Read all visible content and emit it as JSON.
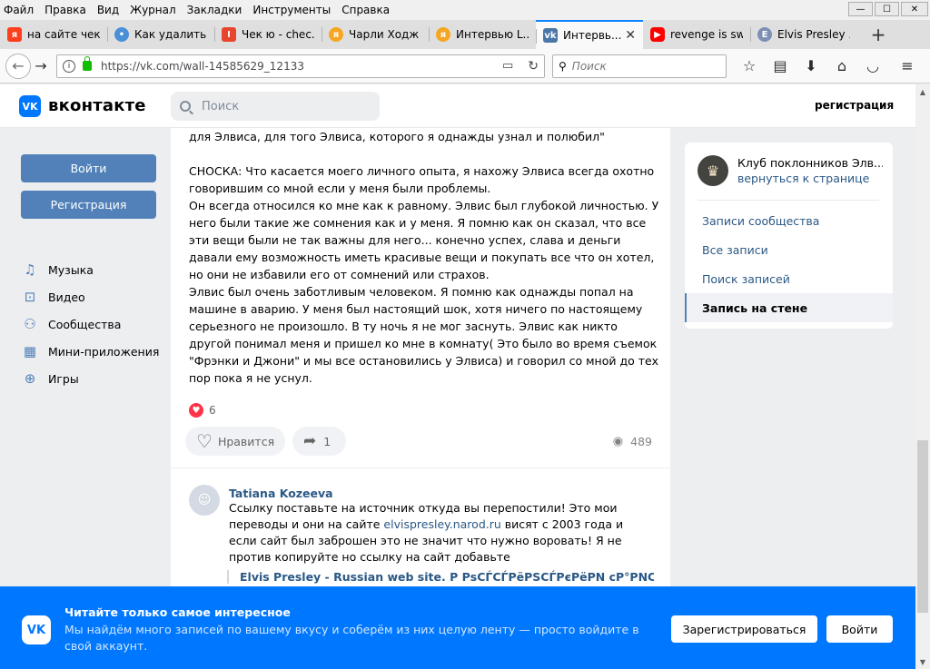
{
  "menubar": {
    "items": [
      "Файл",
      "Правка",
      "Вид",
      "Журнал",
      "Закладки",
      "Инструменты",
      "Справка"
    ],
    "window_controls": {
      "minimize": "—",
      "maximize": "☐",
      "close": "✕"
    }
  },
  "tabs": [
    {
      "title": "на сайте чек...",
      "icon": "yandex-icon",
      "color": "#f33"
    },
    {
      "title": "Как удалить ...",
      "icon": "chat-icon",
      "color": "#4a90d9"
    },
    {
      "title": "Чек ю - chec...",
      "icon": "checkyou-icon",
      "color": "#e8452c"
    },
    {
      "title": "Чарли Ходж ...",
      "icon": "yandex-zen-icon",
      "color": "#f5a623"
    },
    {
      "title": "Интервью L...",
      "icon": "yandex-zen-icon",
      "color": "#f5a623"
    },
    {
      "title": "Интервь...",
      "icon": "vk-icon",
      "color": "#4a76a8",
      "active": true
    },
    {
      "title": "revenge is sw...",
      "icon": "youtube-icon",
      "color": "#f00"
    },
    {
      "title": "Elvis Presley ...",
      "icon": "elvis-site-icon",
      "color": "#7d8fb3"
    }
  ],
  "navbar": {
    "url": "https://vk.com/wall-14585629_12133",
    "search_placeholder": "Поиск"
  },
  "vk": {
    "brand": "вконтакте",
    "search_placeholder": "Поиск",
    "register_link": "регистрация",
    "login_button": "Войти",
    "register_button": "Регистрация",
    "nav": [
      "Музыка",
      "Видео",
      "Сообщества",
      "Мини-приложения",
      "Игры"
    ],
    "post": {
      "text": "для Элвиса, для того Элвиса, которого я однажды узнал и полюбил\"\n\nСНОСКА: Что касается моего личного опыта, я нахожу Элвиса всегда охотно говорившим со мной если у меня были проблемы.\nОн всегда относился ко мне как к равному. Элвис был глубокой личностью. У него были такие же сомнения как и у меня. Я помню как он сказал, что все эти вещи были не так важны для него... конечно успех, слава и деньги давали ему возможность иметь красивые вещи и покупать все что он хотел, но они не избавили его от сомнений или страхов.\nЭлвис был очень заботливым человеком. Я помню как однажды попал на машине в аварию. У меня был настоящий шок, хотя ничего по настоящему серьезного не произошло. В ту ночь я не мог заснуть. Элвис как никто другой понимал меня и пришел ко мне в комнату( Это было во время съемок \"Фрэнки и Джони\" и мы все остановились у Элвиса) и говорил со мной до тех пор пока я не уснул.",
      "likes_count": "6",
      "like_label": "Нравится",
      "share_count": "1",
      "views": "489"
    },
    "comment": {
      "author": "Tatiana Kozeeva",
      "text_before": "Ссылку поставьте на источник откуда вы перепостили! Это мои переводы и они на сайте ",
      "link": "elvispresley.narod.ru",
      "text_after": " висят с 2003 года и если сайт был заброшен это не значит что нужно воровать! Я не против копируйте но ссылку на сайт добавьте",
      "attached_link": "Elvis Presley - Russian web site. Р РѕСЃСЃРёРЅСЃРєРёРN сР°РNС, Р-"
    },
    "sidebar": {
      "club_name": "Клуб поклонников Элв...",
      "club_back": "вернуться к странице",
      "menu": [
        "Записи сообщества",
        "Все записи",
        "Поиск записей",
        "Запись на стене"
      ]
    },
    "banner": {
      "title": "Читайте только самое интересное",
      "text": "Мы найдём много записей по вашему вкусу и соберём из них целую ленту — просто войдите в свой аккаунт.",
      "register_button": "Зарегистрироваться",
      "login_button": "Войти"
    }
  }
}
